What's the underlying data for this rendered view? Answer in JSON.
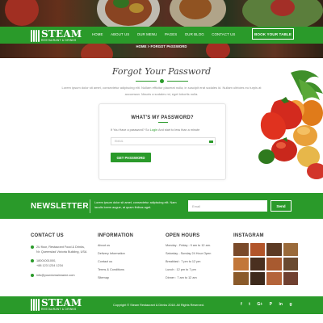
{
  "brand": {
    "name": "STEAM",
    "tagline": "RESTAURANT & DRINKS"
  },
  "nav": {
    "items": [
      "HOME",
      "ABOUT US",
      "OUR MENU",
      "PAGES",
      "OUR BLOG",
      "CONTACT US"
    ],
    "book_button": "BOOK YOUR TABLE"
  },
  "breadcrumb": "HOME > FORGOT PASSWORD",
  "page": {
    "title": "Forgot Your Password",
    "intro": "Lorem ipsum dolor sit amet, consectetur adipiscing elit. Nullam efficitur placerat nulla, in suscipit erat sodales id. Nullam ultricies eu turpis at accumsan. Mauris a sodales mi, eget lobortis nulla."
  },
  "form": {
    "title": "WHAT'S MY PASSWORD?",
    "hint_prefix": "If You Have a password? So",
    "hint_link": "Login",
    "hint_suffix": "And start to less than a minute",
    "email_placeholder": "EMAIL",
    "submit_label": "GET PASSWORD"
  },
  "newsletter": {
    "title": "NEWSLETTER",
    "text": "Lorem ipsum dolor sit amet, consectetur adipiscing elit. Nam iaculis lorem augue, at quam finibus aget.",
    "email_placeholder": "Email",
    "send_label": "Send"
  },
  "footer": {
    "contact": {
      "heading": "CONTACT US",
      "address_line1": "2U floor, Restaurant Food & Drinks,",
      "address_line2": "Nr. Queenslad Victoria Building, USA",
      "phone1": "18001001000,",
      "phone2": "+88 123 1234 1234",
      "email": "info@yourdomainname.com"
    },
    "information": {
      "heading": "INFORMATION",
      "links": [
        "About us",
        "Delivery Information",
        "Contact us",
        "Terms & Conditions",
        "Sitemap"
      ]
    },
    "hours": {
      "heading": "OPEN HOURS",
      "lines": [
        "Monday - Friday : 9 am to 12 am.",
        "Saturday - Sunday 24 Hour Open",
        "Breakfast : 7 pm to 12 pm",
        "Lunch : 12 pm to 7 pm",
        "Dinner : 7 am to 12 am"
      ]
    },
    "instagram": {
      "heading": "INSTAGRAM"
    }
  },
  "bottom": {
    "copyright": "Copyright © Steam Restaurant & Drinks 2018. All Rights Reserved.",
    "socials": [
      "f",
      "t",
      "G+",
      "P",
      "in",
      "g"
    ]
  },
  "colors": {
    "brand_green": "#2a9a2a"
  }
}
